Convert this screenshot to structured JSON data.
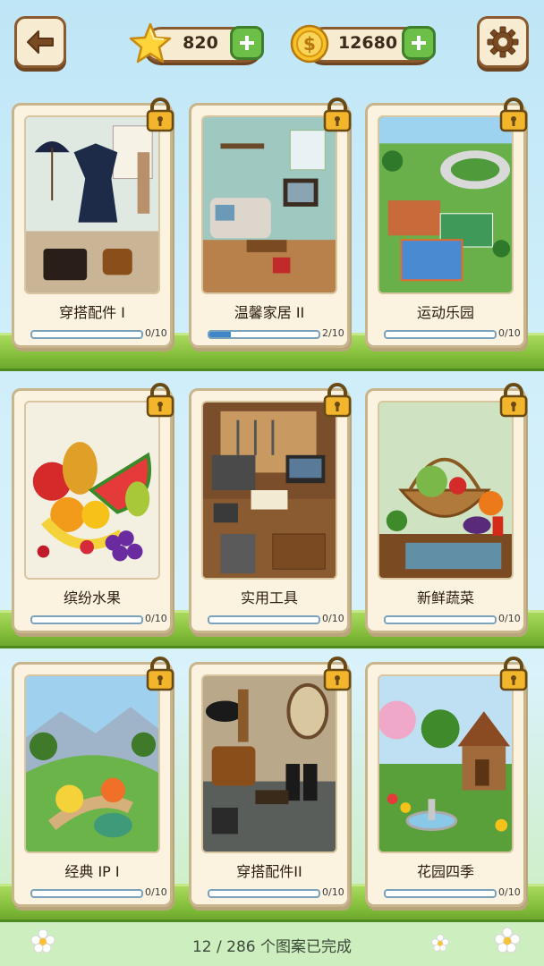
{
  "header": {
    "back_icon": "back-arrow-icon",
    "stars": {
      "icon": "star-icon",
      "value": "820"
    },
    "coins": {
      "icon": "coin-icon",
      "value": "12680"
    },
    "settings_icon": "gear-icon"
  },
  "albums": [
    {
      "title": "穿搭配件 I",
      "count": "0/10",
      "progress": 0.0,
      "locked": true,
      "art": "wardrobe"
    },
    {
      "title": "温馨家居 II",
      "count": "2/10",
      "progress": 0.2,
      "locked": true,
      "art": "livingroom"
    },
    {
      "title": "运动乐园",
      "count": "0/10",
      "progress": 0.0,
      "locked": true,
      "art": "sports"
    },
    {
      "title": "缤纷水果",
      "count": "0/10",
      "progress": 0.0,
      "locked": true,
      "art": "fruit"
    },
    {
      "title": "实用工具",
      "count": "0/10",
      "progress": 0.0,
      "locked": true,
      "art": "tools"
    },
    {
      "title": "新鲜蔬菜",
      "count": "0/10",
      "progress": 0.0,
      "locked": true,
      "art": "vegetables"
    },
    {
      "title": "经典 IP I",
      "count": "0/10",
      "progress": 0.0,
      "locked": true,
      "art": "monsters"
    },
    {
      "title": "穿搭配件II",
      "count": "0/10",
      "progress": 0.0,
      "locked": true,
      "art": "accessories"
    },
    {
      "title": "花园四季",
      "count": "0/10",
      "progress": 0.0,
      "locked": true,
      "art": "garden"
    }
  ],
  "footer": {
    "completion_text": "12 / 286 个图案已完成"
  },
  "colors": {
    "progress_fill": "#3f86c8",
    "shelf_green": "#88c13e",
    "button_green": "#6cc04a",
    "lock_gold": "#f2b52c"
  }
}
